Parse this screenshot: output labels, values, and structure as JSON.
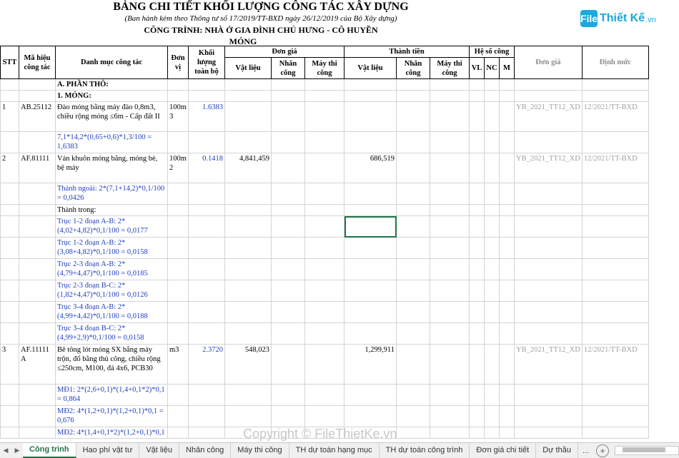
{
  "header": {
    "title": "BẢNG CHI TIẾT KHỐI LƯỢNG CÔNG TÁC XÂY DỰNG",
    "subtitle": "(Ban hành kèm theo Thông tư số 17/2019/TT-BXD ngày 26/12/2019 của Bộ Xây dựng)",
    "project": "CÔNG TRÌNH: NHÀ Ở GIA ĐÌNH CHÚ HƯNG - CÔ HUYỀN",
    "section": "MÓNG"
  },
  "logo": {
    "mark": "File",
    "text": "Thiết Kế",
    "suffix": ".vn"
  },
  "columns": {
    "stt": "STT",
    "ma_hieu": "Mã hiệu công tác",
    "danh_muc": "Danh mục công tác",
    "don_vi": "Đơn vị",
    "khoi_luong": "Khối lượng toàn bộ",
    "don_gia": "Đơn giá",
    "thanh_tien": "Thành tiền",
    "he_so": "Hệ số công",
    "vat_lieu": "Vật liệu",
    "nhan_cong": "Nhân công",
    "may_thi_cong": "Máy thi công",
    "vl": "VL",
    "nc": "NC",
    "m": "M",
    "don_gia2": "Đơn giá",
    "dinh_muc": "Định mức"
  },
  "rows": [
    {
      "desc": "A. PHẦN THÔ:",
      "bold": true
    },
    {
      "desc": "1. MÓNG:",
      "bold": true
    },
    {
      "stt": "1",
      "code": "AB.25112",
      "desc": "Đào móng bằng máy đào 0,8m3, chiều rộng móng ≤6m - Cấp đất II",
      "unit": "100m 3",
      "qty": "1.6383",
      "dg_vl": "",
      "tt_vl": "",
      "dongia": "YB_2021_TT12_XD",
      "dinhmuc": "12/2021/TT-BXD"
    },
    {
      "desc": "7,1*14,2*(0,65+0,6)*1,3/100 = 1,6383",
      "blue": true,
      "tall": true
    },
    {
      "stt": "2",
      "code": "AF.81111",
      "desc": "Ván khuôn móng băng, móng bè, bệ máy",
      "unit": "100m 2",
      "qty": "0.1418",
      "dg_vl": "4,841,459",
      "tt_vl": "686,519",
      "dongia": "YB_2021_TT12_XD",
      "dinhmuc": "12/2021/TT-BXD"
    },
    {
      "desc": "Thành ngoài: 2*(7,1+14,2)*0,1/100 = 0,0426",
      "blue": true
    },
    {
      "desc": "Thành trong:"
    },
    {
      "desc": "Trục 1-2 đoạn A-B: 2*(4,02+4,82)*0,1/100 = 0,0177",
      "blue": true,
      "selected": true
    },
    {
      "desc": "Trục 1-2 đoạn A-B: 2*(3,08+4,82)*0,1/100 = 0,0158",
      "blue": true
    },
    {
      "desc": "Trục 2-3 đoạn A-B: 2*(4,79+4,47)*0,1/100 = 0,0185",
      "blue": true
    },
    {
      "desc": "Trục 2-3 đoạn B-C: 2*(1,82+4,47)*0,1/100 = 0,0126",
      "blue": true
    },
    {
      "desc": "Trục 3-4 đoạn A-B: 2*(4,99+4,42)*0,1/100 = 0,0188",
      "blue": true
    },
    {
      "desc": "Trục 3-4 đoạn B-C: 2*(4,99+2,9)*0,1/100 = 0,0158",
      "blue": true
    },
    {
      "stt": "3",
      "code": "AF.11111 A",
      "desc": "Bê tông lót móng SX bằng máy trộn, đổ bằng thủ công, chiều rộng ≤250cm, M100, đá 4x6, PCB30",
      "unit": "m3",
      "qty": "2.3720",
      "dg_vl": "548,023",
      "tt_vl": "1,299,911",
      "dongia": "YB_2021_TT12_XD",
      "dinhmuc": "12/2021/TT-BXD"
    },
    {
      "desc": "MĐ1: 2*(2,6+0,1)*(1,4+0,1*2)*0,1 = 0,864",
      "blue": true,
      "tall": true
    },
    {
      "desc": "MĐ2: 4*(1,2+0,1)*(1,2+0,1)*0,1 = 0,676",
      "blue": true,
      "tall": true
    },
    {
      "desc": "MĐ2: 4*(1,4+0,1*2)*(1,2+0,1)*0,1",
      "blue": true
    }
  ],
  "watermark": "Copyright © FileThietKe.vn",
  "tabs": [
    {
      "label": "Công trình",
      "active": true
    },
    {
      "label": "Hao phí vật tư"
    },
    {
      "label": "Vật liệu"
    },
    {
      "label": "Nhân công"
    },
    {
      "label": "Máy thi công"
    },
    {
      "label": "TH dự toán hạng mục"
    },
    {
      "label": "TH dự toán công trình"
    },
    {
      "label": "Đơn giá chi tiết"
    },
    {
      "label": "Dự thầu"
    }
  ],
  "tab_more": "...",
  "colors": {
    "accent": "#217346",
    "formula_blue": "#1f3fbf",
    "logo": "#19a9dc"
  }
}
